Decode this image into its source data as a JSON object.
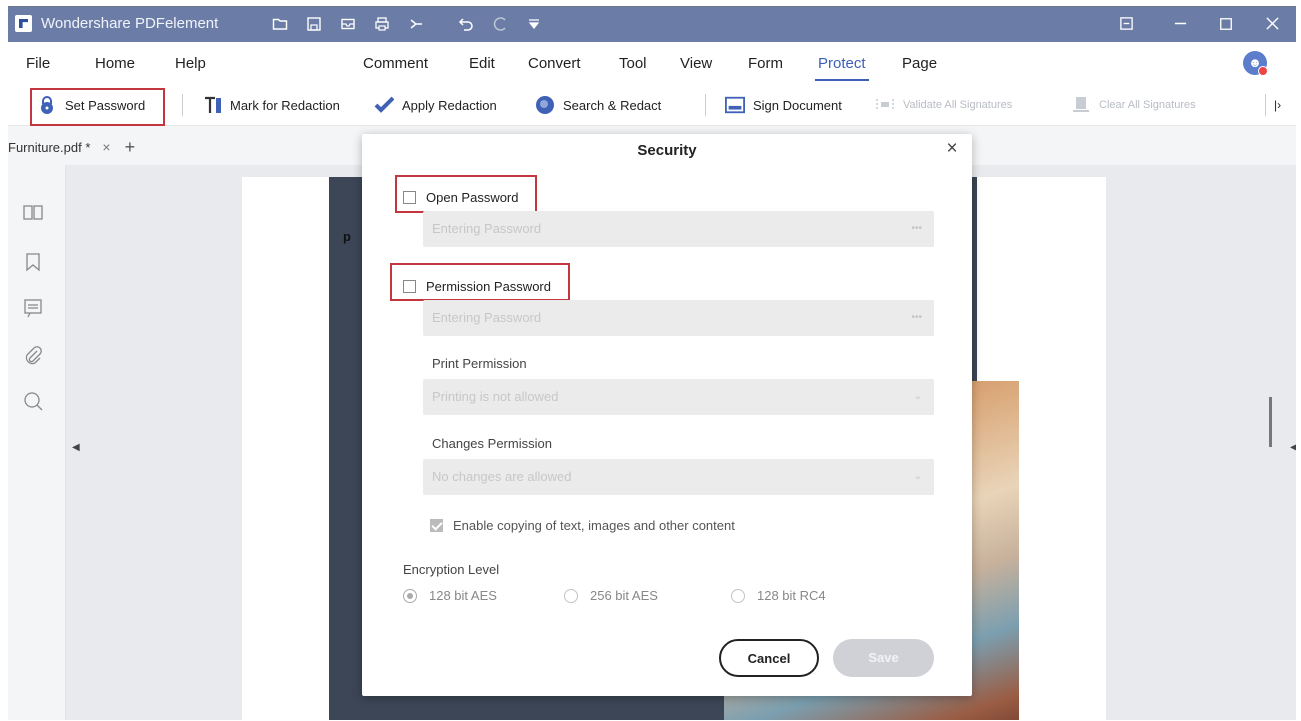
{
  "titlebar": {
    "app_title": "Wondershare PDFelement",
    "quick_icons": [
      "folder-icon",
      "save-icon",
      "mail-icon",
      "print-icon",
      "share-icon",
      "undo-icon",
      "redo-icon",
      "dropdown-icon"
    ],
    "window_icons": [
      "panel-icon",
      "minimize-icon",
      "maximize-icon",
      "close-icon"
    ]
  },
  "menubar": {
    "items": [
      "File",
      "Home",
      "Help",
      "Comment",
      "Edit",
      "Convert",
      "Tool",
      "View",
      "Form",
      "Protect",
      "Page"
    ],
    "active": "Protect"
  },
  "toolbar": {
    "set_password": "Set Password",
    "mark_for_redaction": "Mark for Redaction",
    "apply_redaction": "Apply Redaction",
    "search_redact": "Search & Redact",
    "sign_document": "Sign Document",
    "validate_all_signatures": "Validate All Signatures",
    "clear_all_signatures": "Clear All Signatures"
  },
  "tabs": {
    "file_tab": "Furniture.pdf *",
    "close_glyph": "×",
    "add_glyph": "+"
  },
  "document": {
    "page_fragment": "p"
  },
  "dialog": {
    "title": "Security",
    "close_glyph": "×",
    "open_password_label": "Open Password",
    "open_password_placeholder": "Entering Password",
    "permission_password_label": "Permission Password",
    "permission_password_placeholder": "Entering Password",
    "print_permission_label": "Print Permission",
    "print_permission_value": "Printing is not allowed",
    "changes_permission_label": "Changes Permission",
    "changes_permission_value": "No changes are allowed",
    "enable_copying_label": "Enable copying of text, images and other content",
    "enable_copying_checked": true,
    "encryption_level_label": "Encryption Level",
    "encryption_options": [
      "128 bit AES",
      "256 bit AES",
      "128 bit RC4"
    ],
    "encryption_selected": "128 bit AES",
    "cancel_label": "Cancel",
    "save_label": "Save"
  },
  "colors": {
    "titlebar": "#6b7da6",
    "accent": "#3d5fb8",
    "highlight_box": "#c3363d"
  }
}
